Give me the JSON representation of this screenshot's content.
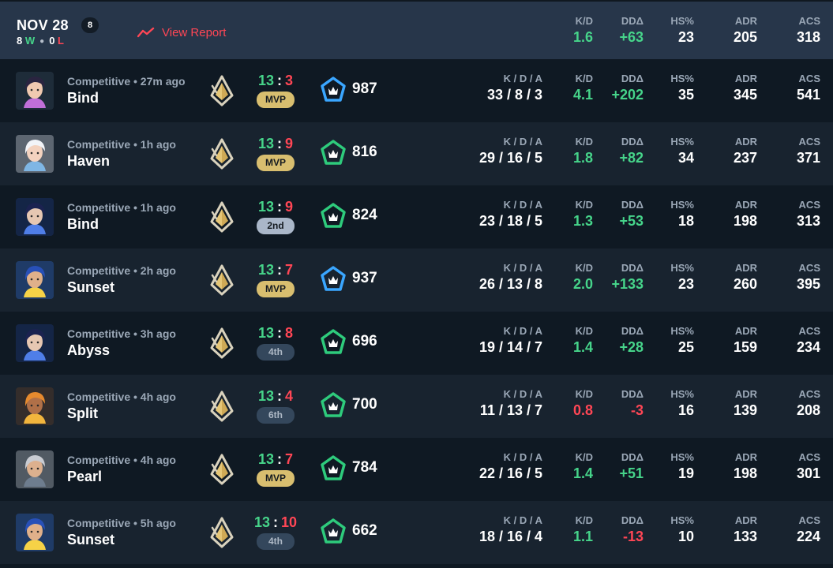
{
  "header": {
    "date": "NOV 28",
    "match_count": "8",
    "wins": "8",
    "win_letter": "W",
    "losses": "0",
    "loss_letter": "L",
    "view_report_label": "View Report",
    "stats": [
      {
        "key": "kd",
        "label": "K/D",
        "value": "1.6",
        "tone": "pos"
      },
      {
        "key": "dd",
        "label": "DDΔ",
        "value": "+63",
        "tone": "pos"
      },
      {
        "key": "hs",
        "label": "HS%",
        "value": "23",
        "tone": "neutral"
      },
      {
        "key": "adr",
        "label": "ADR",
        "value": "205",
        "tone": "neutral"
      },
      {
        "key": "acs",
        "label": "ACS",
        "value": "318",
        "tone": "neutral"
      }
    ]
  },
  "colors": {
    "win": "#46d48a",
    "loss": "#ff4655",
    "mvp_badge": "#d8be6f",
    "second_badge": "#aab7c9",
    "other_badge": "#34475c",
    "header_bg": "#27364a",
    "row_dark": "#0f1923",
    "row_light": "#18232f"
  },
  "labels": {
    "kda": "K / D / A",
    "kd": "K/D",
    "dd": "DDΔ",
    "hs": "HS%",
    "adr": "ADR",
    "acs": "ACS"
  },
  "matches": [
    {
      "mode": "Competitive • 27m ago",
      "map": "Bind",
      "agent_icon": "agent-clove-portrait",
      "rank_icon": "ascendant-rank-icon",
      "score_us": "13",
      "score_them": "3",
      "placement": "MVP",
      "placement_kind": "mvp",
      "tier_icon": "blue-tier-icon",
      "tier_color": "blue",
      "rr": "987",
      "kda": "33 / 8 / 3",
      "kd": "4.1",
      "kd_tone": "pos",
      "dd": "+202",
      "dd_tone": "pos",
      "hs": "35",
      "adr": "345",
      "acs": "541"
    },
    {
      "mode": "Competitive • 1h ago",
      "map": "Haven",
      "agent_icon": "agent-jett-portrait",
      "rank_icon": "ascendant-rank-icon",
      "score_us": "13",
      "score_them": "9",
      "placement": "MVP",
      "placement_kind": "mvp",
      "tier_icon": "green-tier-icon",
      "tier_color": "green",
      "rr": "816",
      "kda": "29 / 16 / 5",
      "kd": "1.8",
      "kd_tone": "pos",
      "dd": "+82",
      "dd_tone": "pos",
      "hs": "34",
      "adr": "237",
      "acs": "371"
    },
    {
      "mode": "Competitive • 1h ago",
      "map": "Bind",
      "agent_icon": "agent-yoru-portrait",
      "rank_icon": "ascendant-rank-icon",
      "score_us": "13",
      "score_them": "9",
      "placement": "2nd",
      "placement_kind": "second",
      "tier_icon": "green-tier-icon",
      "tier_color": "green",
      "rr": "824",
      "kda": "23 / 18 / 5",
      "kd": "1.3",
      "kd_tone": "pos",
      "dd": "+53",
      "dd_tone": "pos",
      "hs": "18",
      "adr": "198",
      "acs": "313"
    },
    {
      "mode": "Competitive • 2h ago",
      "map": "Sunset",
      "agent_icon": "agent-neon-portrait",
      "rank_icon": "ascendant-rank-icon",
      "score_us": "13",
      "score_them": "7",
      "placement": "MVP",
      "placement_kind": "mvp",
      "tier_icon": "blue-tier-icon",
      "tier_color": "blue",
      "rr": "937",
      "kda": "26 / 13 / 8",
      "kd": "2.0",
      "kd_tone": "pos",
      "dd": "+133",
      "dd_tone": "pos",
      "hs": "23",
      "adr": "260",
      "acs": "395"
    },
    {
      "mode": "Competitive • 3h ago",
      "map": "Abyss",
      "agent_icon": "agent-yoru-portrait",
      "rank_icon": "ascendant-rank-icon",
      "score_us": "13",
      "score_them": "8",
      "placement": "4th",
      "placement_kind": "other",
      "tier_icon": "green-tier-icon",
      "tier_color": "green",
      "rr": "696",
      "kda": "19 / 14 / 7",
      "kd": "1.4",
      "kd_tone": "pos",
      "dd": "+28",
      "dd_tone": "pos",
      "hs": "25",
      "adr": "159",
      "acs": "234"
    },
    {
      "mode": "Competitive • 4h ago",
      "map": "Split",
      "agent_icon": "agent-raze-portrait",
      "rank_icon": "ascendant-rank-icon",
      "score_us": "13",
      "score_them": "4",
      "placement": "6th",
      "placement_kind": "other",
      "tier_icon": "green-tier-icon",
      "tier_color": "green",
      "rr": "700",
      "kda": "11 / 13 / 7",
      "kd": "0.8",
      "kd_tone": "neg",
      "dd": "-3",
      "dd_tone": "neg",
      "hs": "16",
      "adr": "139",
      "acs": "208"
    },
    {
      "mode": "Competitive • 4h ago",
      "map": "Pearl",
      "agent_icon": "agent-iso-portrait",
      "rank_icon": "ascendant-rank-icon",
      "score_us": "13",
      "score_them": "7",
      "placement": "MVP",
      "placement_kind": "mvp",
      "tier_icon": "green-tier-icon",
      "tier_color": "green",
      "rr": "784",
      "kda": "22 / 16 / 5",
      "kd": "1.4",
      "kd_tone": "pos",
      "dd": "+51",
      "dd_tone": "pos",
      "hs": "19",
      "adr": "198",
      "acs": "301"
    },
    {
      "mode": "Competitive • 5h ago",
      "map": "Sunset",
      "agent_icon": "agent-neon-portrait",
      "rank_icon": "ascendant-rank-icon",
      "score_us": "13",
      "score_them": "10",
      "placement": "4th",
      "placement_kind": "other",
      "tier_icon": "green-tier-icon",
      "tier_color": "green",
      "rr": "662",
      "kda": "18 / 16 / 4",
      "kd": "1.1",
      "kd_tone": "pos",
      "dd": "-13",
      "dd_tone": "neg",
      "hs": "10",
      "adr": "133",
      "acs": "224"
    }
  ]
}
